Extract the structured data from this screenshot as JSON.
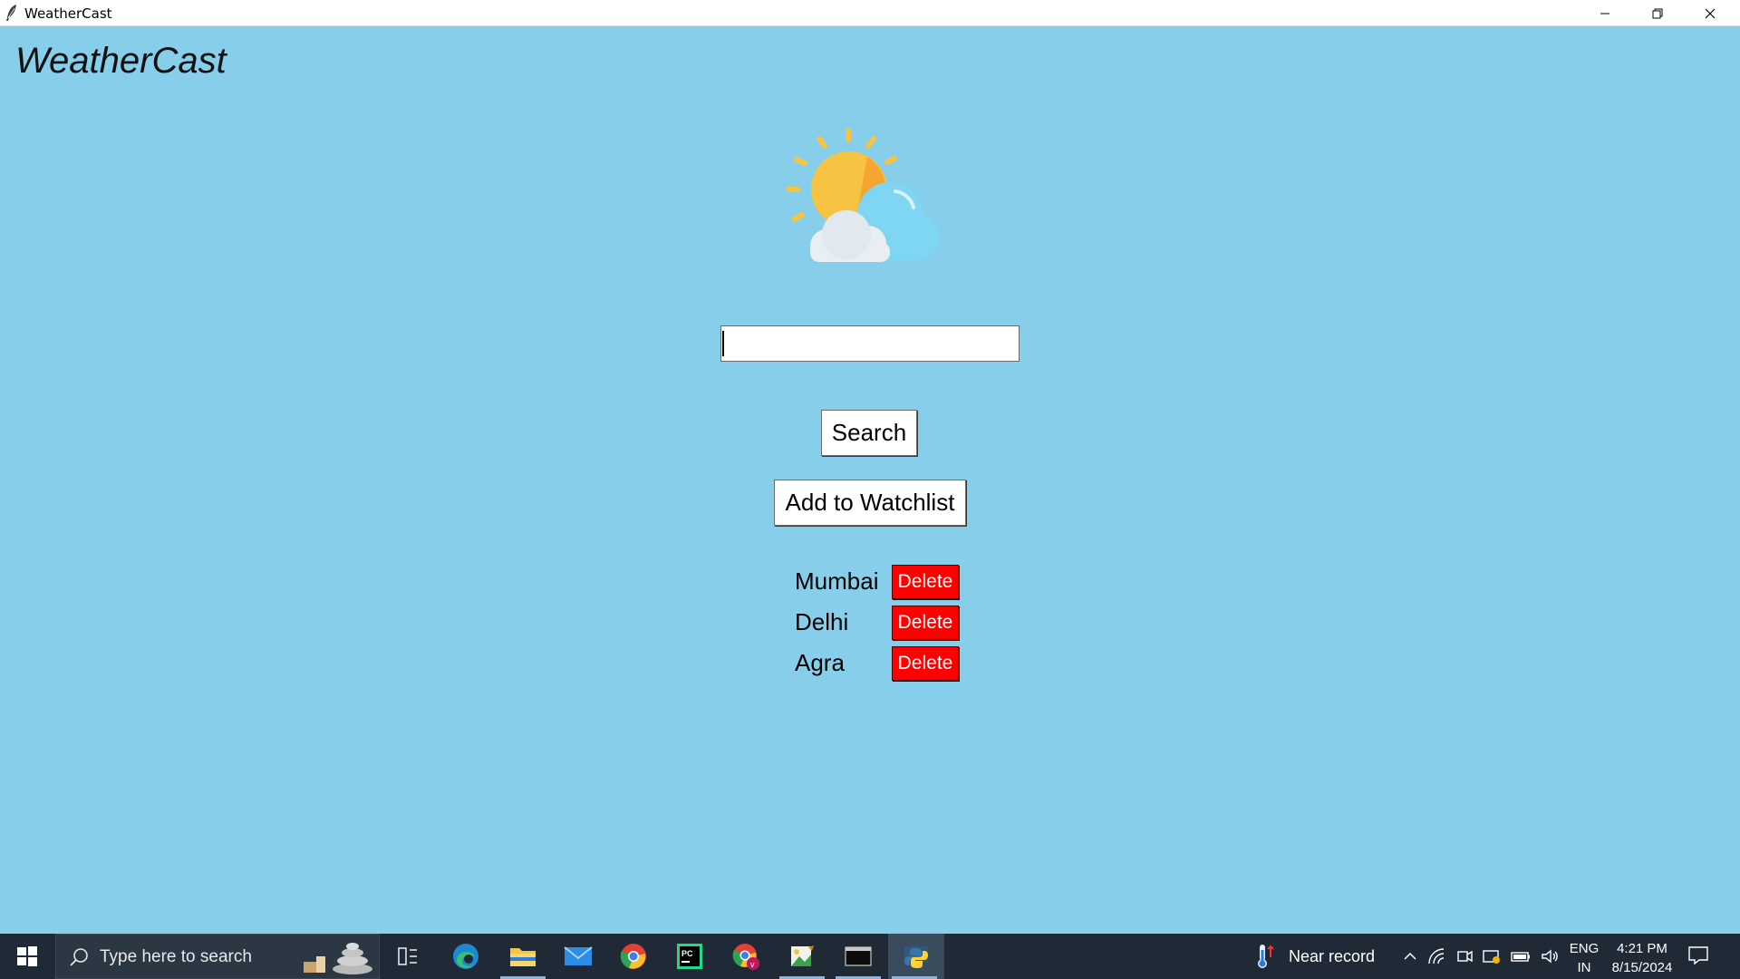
{
  "window": {
    "title": "WeatherCast"
  },
  "app": {
    "brand": "WeatherCast",
    "search": {
      "value": "",
      "placeholder": ""
    },
    "search_button": "Search",
    "watchlist_button": "Add to Watchlist",
    "watchlist": [
      {
        "city": "Mumbai",
        "delete_label": "Delete"
      },
      {
        "city": "Delhi",
        "delete_label": "Delete"
      },
      {
        "city": "Agra",
        "delete_label": "Delete"
      }
    ],
    "colors": {
      "background": "#87ceeb",
      "delete": "#ff0000"
    }
  },
  "taskbar": {
    "search_placeholder": "Type here to search",
    "apps": [
      "task-view",
      "edge",
      "file-explorer",
      "mail",
      "chrome",
      "pycharm",
      "chrome-profile",
      "image-viewer",
      "terminal",
      "python"
    ],
    "weather_text": "Near record",
    "language": {
      "line1": "ENG",
      "line2": "IN"
    },
    "clock": {
      "time": "4:21 PM",
      "date": "8/15/2024"
    }
  }
}
